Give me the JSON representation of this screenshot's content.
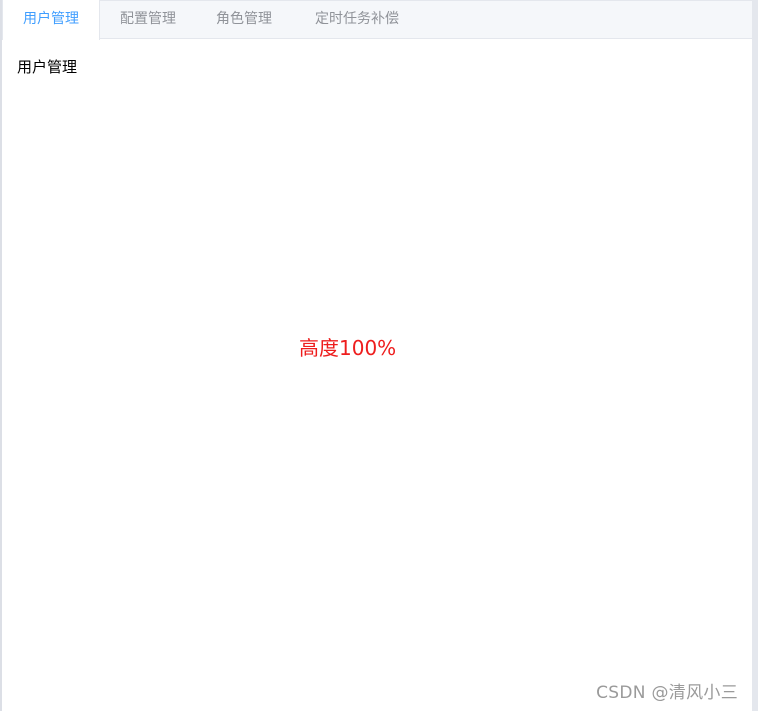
{
  "tabs": [
    {
      "label": "用户管理",
      "active": true
    },
    {
      "label": "配置管理",
      "active": false
    },
    {
      "label": "角色管理",
      "active": false
    },
    {
      "label": "定时任务补偿",
      "active": false
    }
  ],
  "content": {
    "title": "用户管理",
    "height_label": "高度100%"
  },
  "watermark": "CSDN @清风小三",
  "colors": {
    "active_tab": "#409eff",
    "inactive_tab": "#909399",
    "highlight_text": "#ee1d1d"
  }
}
